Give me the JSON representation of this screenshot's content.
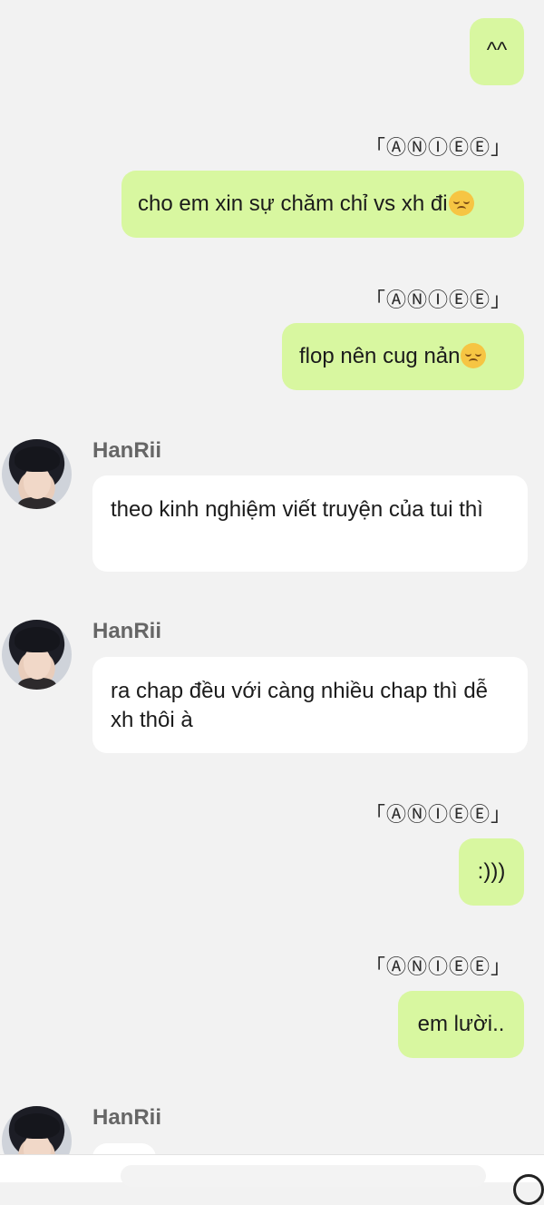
{
  "messages": [
    {
      "sender": "「ⒶⓃⒾⒺⒺ」",
      "text": "^^"
    },
    {
      "sender": "「ⒶⓃⒾⒺⒺ」",
      "text": "cho em xin sự chăm chỉ vs xh đi",
      "emoji": "disappointed-face"
    },
    {
      "sender": "「ⒶⓃⒾⒺⒺ」",
      "text": "flop nên cug nản",
      "emoji": "disappointed-face"
    },
    {
      "sender": "HanRii",
      "text": "theo kinh nghiệm viết truyện của tui thì"
    },
    {
      "sender": "HanRii",
      "text": "ra chap đều với càng nhiều chap thì dễ xh thôi à"
    },
    {
      "sender": "「ⒶⓃⒾⒺⒺ」",
      "text": ":)))"
    },
    {
      "sender": "「ⒶⓃⒾⒺⒺ」",
      "text": "em lười.."
    },
    {
      "sender": "HanRii",
      "text": ""
    }
  ],
  "colors": {
    "outgoing_bubble": "#d8f7a0",
    "incoming_bubble": "#ffffff",
    "background": "#f2f2f2"
  }
}
